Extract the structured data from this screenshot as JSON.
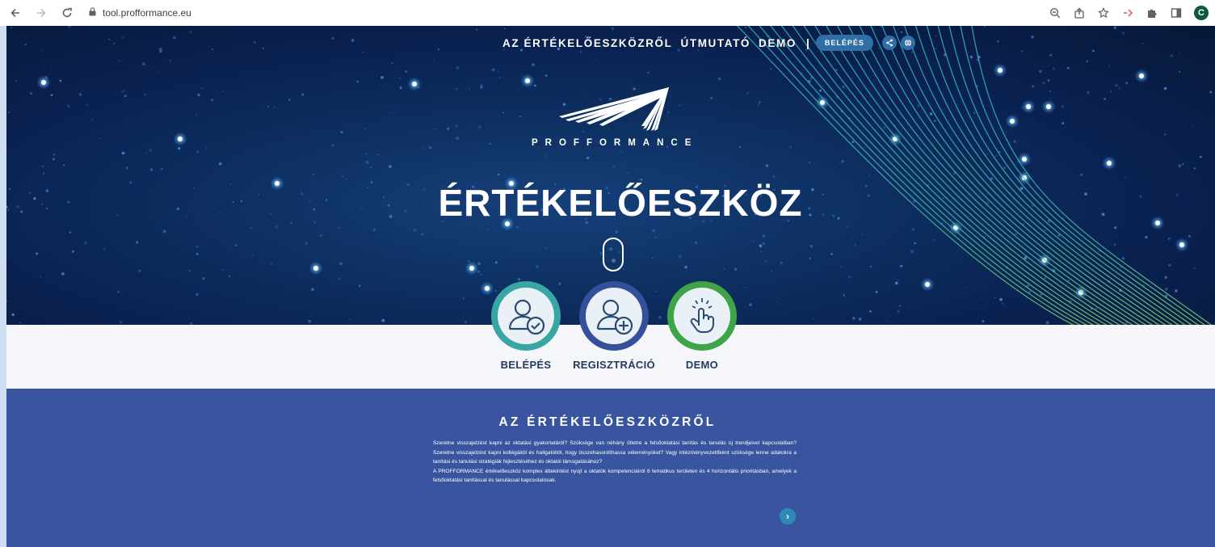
{
  "browser": {
    "url": "tool.profformance.eu",
    "profile_initial": "C"
  },
  "nav": {
    "about": "AZ ÉRTÉKELŐESZKÖZRŐL",
    "guide": "ÚTMUTATÓ",
    "demo": "DEMO",
    "separator": "|",
    "login": "BELÉPÉS"
  },
  "hero": {
    "brand": "PROFFORMANCE",
    "title": "ÉRTÉKELŐESZKÖZ"
  },
  "actions": [
    {
      "label": "BELÉPÉS",
      "icon": "user-check-icon",
      "ring_color": "#3aa6a3"
    },
    {
      "label": "REGISZTRÁCIÓ",
      "icon": "user-plus-icon",
      "ring_color": "#35509a"
    },
    {
      "label": "DEMO",
      "icon": "hand-pointer-icon",
      "ring_color": "#3fa348"
    }
  ],
  "about": {
    "title": "AZ ÉRTÉKELŐESZKÖZRŐL",
    "paragraph1": "Szeretne visszajelzést kapni az oktatási gyakorlatáról? Szüksége van néhány ötletre a felsőoktatási tanítás és tanulás új trendjeivel kapcsolatban? Szeretne visszajelzést kapni kollégáitól és hallgatóitól, hogy összehasonlíthassa véleményüket? Vagy intézményvezetőként szüksége lenne adatokra a tanítási és tanulási stratégiák fejlesztéséhez és oktatói támogatásához?",
    "paragraph2": "A PROFFORMANCE értékelőeszköz komplex áttekintést nyújt a oktatók kompetenciáiról 6 tematikus területen és 4 horizontális prioritásban, amelyek a felsőoktatási tanítással és tanulással kapcsolatosak.",
    "next_glyph": "›"
  },
  "colors": {
    "hero_bg": "#0a2150",
    "band_bg": "#f5f6fa",
    "about_bg": "#3a559f",
    "accent": "#2f6fa6"
  }
}
